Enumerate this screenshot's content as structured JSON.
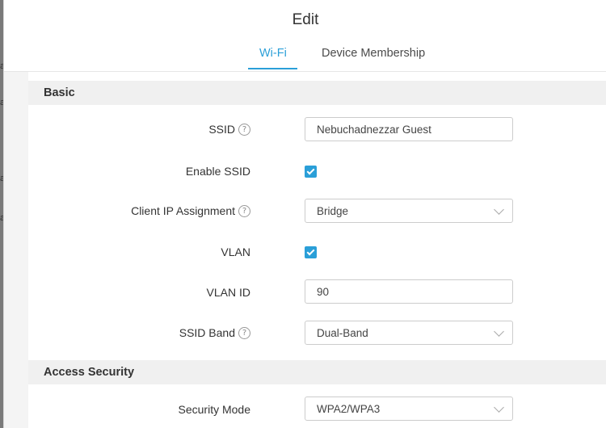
{
  "dialog": {
    "title": "Edit",
    "tabs": [
      {
        "label": "Wi-Fi",
        "active": true
      },
      {
        "label": "Device Membership",
        "active": false
      }
    ]
  },
  "sections": {
    "basic": "Basic",
    "access_security": "Access Security"
  },
  "form": {
    "ssid": {
      "label": "SSID",
      "value": "Nebuchadnezzar Guest"
    },
    "enable_ssid": {
      "label": "Enable SSID",
      "checked": true
    },
    "client_ip": {
      "label": "Client IP Assignment",
      "value": "Bridge"
    },
    "vlan": {
      "label": "VLAN",
      "checked": true
    },
    "vlan_id": {
      "label": "VLAN ID",
      "value": "90"
    },
    "ssid_band": {
      "label": "SSID Band",
      "value": "Dual-Band"
    },
    "security_mode": {
      "label": "Security Mode",
      "value": "WPA2/WPA3"
    }
  },
  "icons": {
    "help": "?",
    "check": "checkmark-icon",
    "dropdown": "chevron-down-icon"
  },
  "colors": {
    "accent": "#2a9fd8",
    "section_bg": "#f0f0f0"
  }
}
